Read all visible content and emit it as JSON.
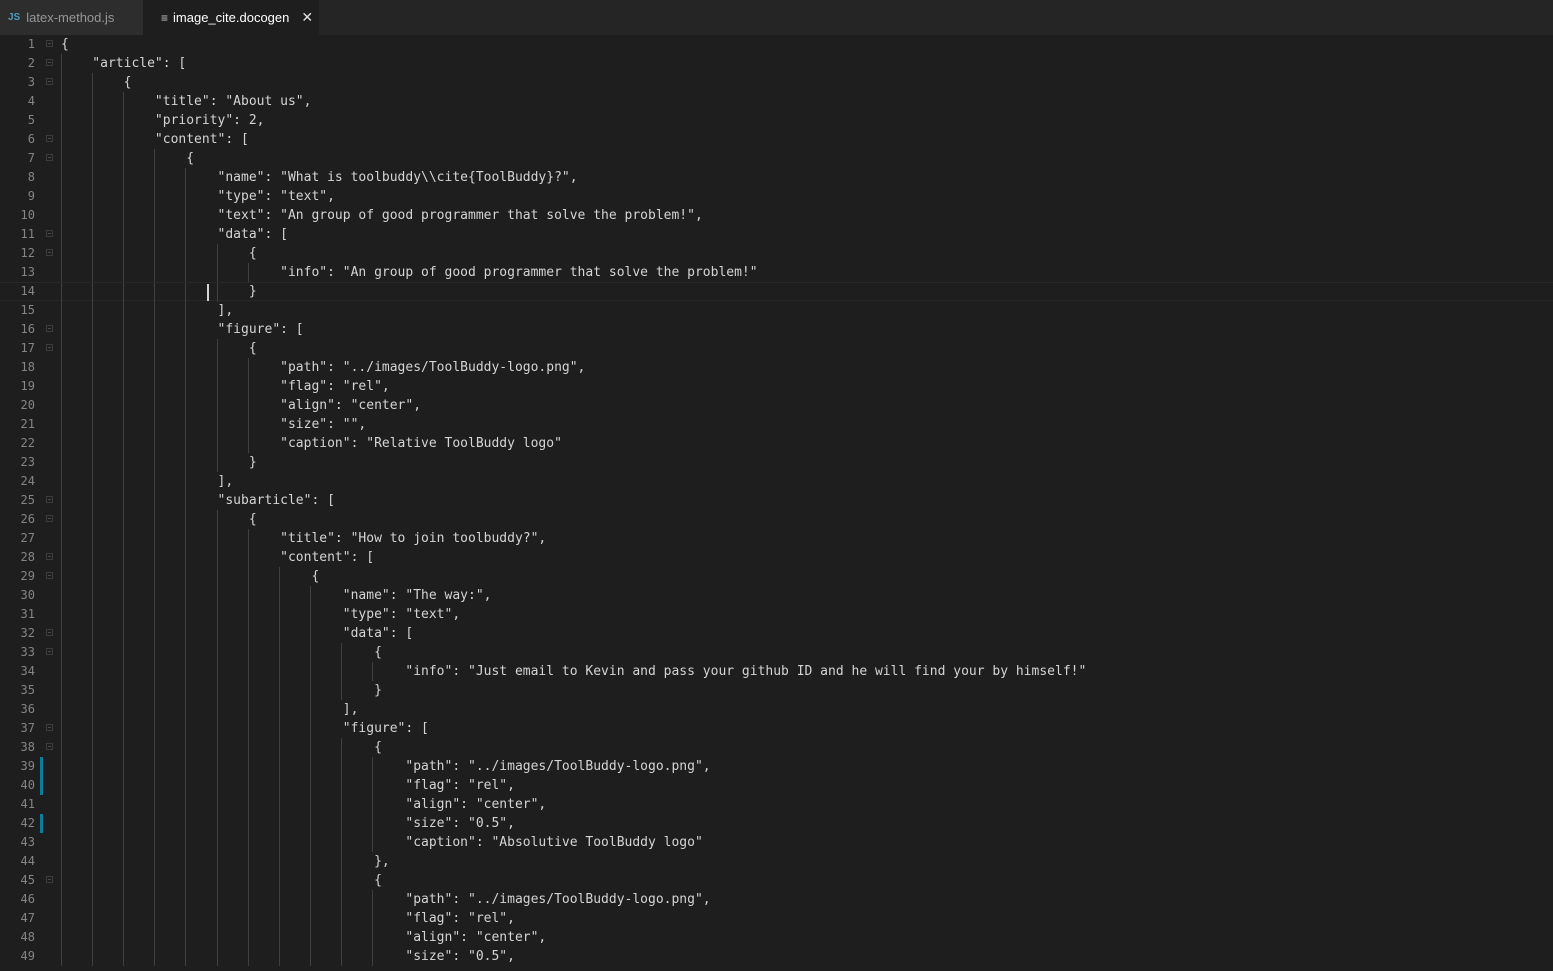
{
  "tabs": [
    {
      "label": "latex-method.js",
      "icon": "js-icon",
      "icon_text": "JS"
    },
    {
      "label": "image_cite.docogen",
      "icon": "file-icon",
      "icon_text": "≡",
      "active": true
    }
  ],
  "close_glyph": "✕",
  "cursor_line": 14,
  "lines": [
    {
      "n": "1",
      "text": "{"
    },
    {
      "n": "2",
      "text": "    \"article\": ["
    },
    {
      "n": "3",
      "text": "        {"
    },
    {
      "n": "4",
      "text": "            \"title\": \"About us\","
    },
    {
      "n": "5",
      "text": "            \"priority\": 2,"
    },
    {
      "n": "6",
      "text": "            \"content\": ["
    },
    {
      "n": "7",
      "text": "                {"
    },
    {
      "n": "8",
      "text": "                    \"name\": \"What is toolbuddy\\\\cite{ToolBuddy}?\","
    },
    {
      "n": "9",
      "text": "                    \"type\": \"text\","
    },
    {
      "n": "10",
      "text": "                    \"text\": \"An group of good programmer that solve the problem!\","
    },
    {
      "n": "11",
      "text": "                    \"data\": ["
    },
    {
      "n": "12",
      "text": "                        {"
    },
    {
      "n": "13",
      "text": "                            \"info\": \"An group of good programmer that solve the problem!\""
    },
    {
      "n": "14",
      "text": "                        }"
    },
    {
      "n": "15",
      "text": "                    ],"
    },
    {
      "n": "16",
      "text": "                    \"figure\": ["
    },
    {
      "n": "17",
      "text": "                        {"
    },
    {
      "n": "18",
      "text": "                            \"path\": \"../images/ToolBuddy-logo.png\","
    },
    {
      "n": "19",
      "text": "                            \"flag\": \"rel\","
    },
    {
      "n": "20",
      "text": "                            \"align\": \"center\","
    },
    {
      "n": "21",
      "text": "                            \"size\": \"\","
    },
    {
      "n": "22",
      "text": "                            \"caption\": \"Relative ToolBuddy logo\""
    },
    {
      "n": "23",
      "text": "                        }"
    },
    {
      "n": "24",
      "text": "                    ],"
    },
    {
      "n": "25",
      "text": "                    \"subarticle\": ["
    },
    {
      "n": "26",
      "text": "                        {"
    },
    {
      "n": "27",
      "text": "                            \"title\": \"How to join toolbuddy?\","
    },
    {
      "n": "28",
      "text": "                            \"content\": ["
    },
    {
      "n": "29",
      "text": "                                {"
    },
    {
      "n": "30",
      "text": "                                    \"name\": \"The way:\","
    },
    {
      "n": "31",
      "text": "                                    \"type\": \"text\","
    },
    {
      "n": "32",
      "text": "                                    \"data\": ["
    },
    {
      "n": "33",
      "text": "                                        {"
    },
    {
      "n": "34",
      "text": "                                            \"info\": \"Just email to Kevin and pass your github ID and he will find your by himself!\""
    },
    {
      "n": "35",
      "text": "                                        }"
    },
    {
      "n": "36",
      "text": "                                    ],"
    },
    {
      "n": "37",
      "text": "                                    \"figure\": ["
    },
    {
      "n": "38",
      "text": "                                        {"
    },
    {
      "n": "39",
      "text": "                                            \"path\": \"../images/ToolBuddy-logo.png\","
    },
    {
      "n": "40",
      "text": "                                            \"flag\": \"rel\","
    },
    {
      "n": "41",
      "text": "                                            \"align\": \"center\","
    },
    {
      "n": "42",
      "text": "                                            \"size\": \"0.5\","
    },
    {
      "n": "43",
      "text": "                                            \"caption\": \"Absolutive ToolBuddy logo\""
    },
    {
      "n": "44",
      "text": "                                        },"
    },
    {
      "n": "45",
      "text": "                                        {"
    },
    {
      "n": "46",
      "text": "                                            \"path\": \"../images/ToolBuddy-logo.png\","
    },
    {
      "n": "47",
      "text": "                                            \"flag\": \"rel\","
    },
    {
      "n": "48",
      "text": "                                            \"align\": \"center\","
    },
    {
      "n": "49",
      "text": "                                            \"size\": \"0.5\","
    }
  ],
  "fold_lines": [
    "1",
    "2",
    "3",
    "6",
    "7",
    "11",
    "12",
    "16",
    "17",
    "25",
    "26",
    "28",
    "29",
    "32",
    "33",
    "37",
    "38",
    "45"
  ],
  "modified_lines": [
    "39",
    "40",
    "42"
  ]
}
